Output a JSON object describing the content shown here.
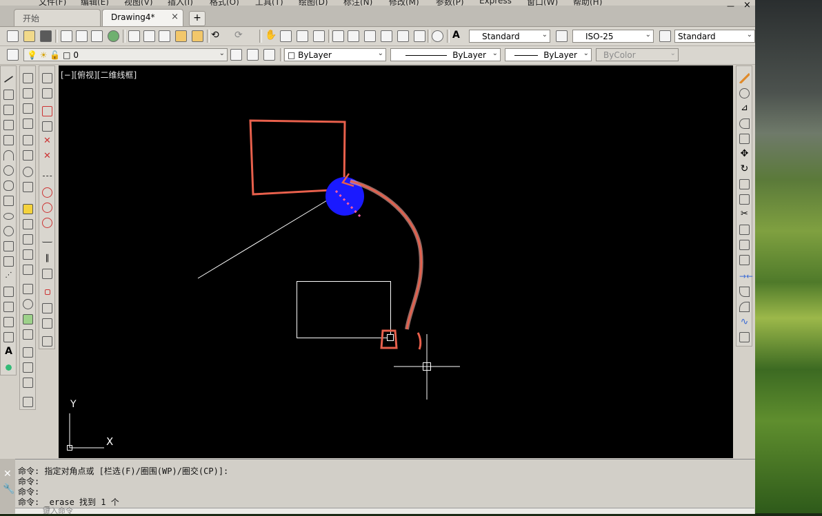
{
  "menu": [
    "文件(F)",
    "编辑(E)",
    "视图(V)",
    "插入(I)",
    "格式(O)",
    "工具(T)",
    "绘图(D)",
    "标注(N)",
    "修改(M)",
    "参数(P)",
    "Express",
    "窗口(W)",
    "帮助(H)"
  ],
  "tabs": {
    "start": "开始",
    "drawing": "Drawing4*",
    "close": "×",
    "add": "+"
  },
  "window_buttons": {
    "minimize": "—",
    "close": "×"
  },
  "styles": {
    "text_style": "Standard",
    "dim_style": "ISO-25",
    "table_style": "Standard"
  },
  "layers": {
    "current_layer": "0",
    "color": "ByLayer",
    "linetype": "ByLayer",
    "lineweight": "ByLayer",
    "plotstyle": "ByColor"
  },
  "viewport": {
    "label": "[−][俯视][二维线框]"
  },
  "ucs": {
    "x": "X",
    "y": "Y"
  },
  "command": {
    "lines": [
      "命令: 指定对角点或 [栏选(F)/圈围(WP)/圈交(CP)]:",
      "命令:",
      "命令:",
      "命令: _erase 找到 1 个"
    ],
    "prompt": "键入命令"
  },
  "colors": {
    "canvas": "#000000",
    "annotation": "#e8604c",
    "highlight": "#1a1aff",
    "entity": "#ffffff"
  }
}
